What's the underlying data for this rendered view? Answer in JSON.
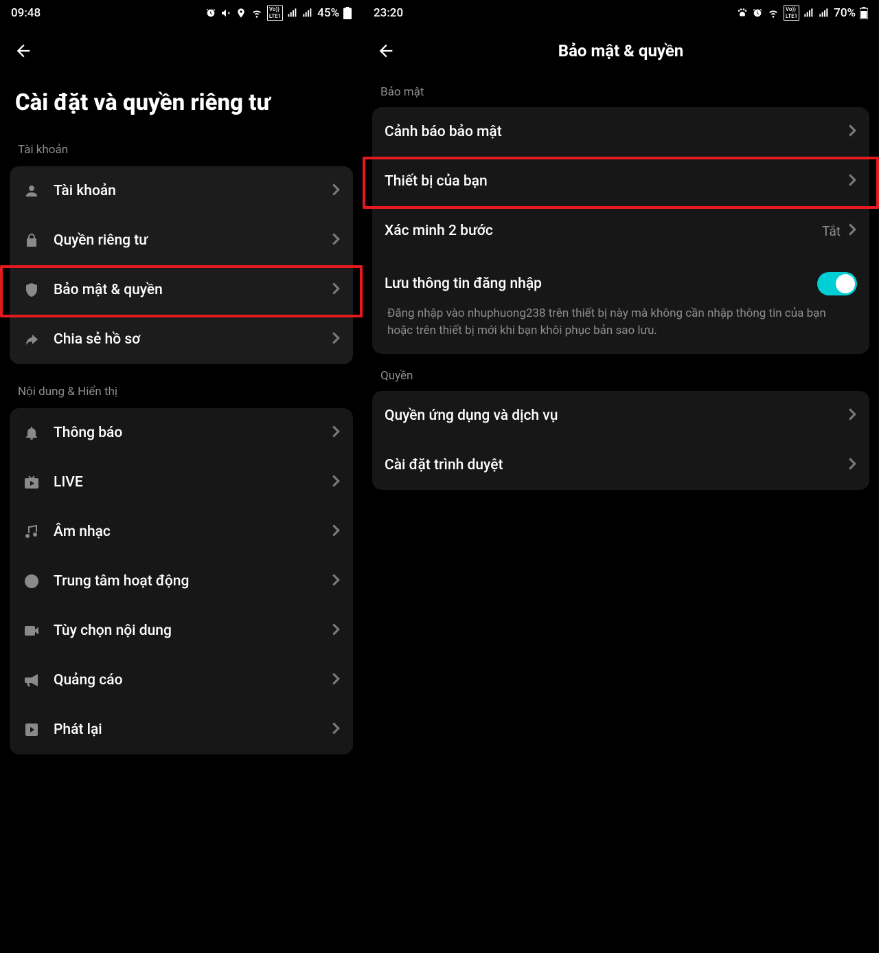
{
  "left": {
    "status": {
      "time": "09:48",
      "battery": "45%"
    },
    "title": "Cài đặt và quyền riêng tư",
    "section_account": "Tài khoản",
    "section_content": "Nội dung & Hiển thị",
    "rows_account": {
      "account": "Tài khoản",
      "privacy": "Quyền riêng tư",
      "security": "Bảo mật & quyền",
      "share": "Chia sẻ hồ sơ"
    },
    "rows_content": {
      "notify": "Thông báo",
      "live": "LIVE",
      "music": "Âm nhạc",
      "activity": "Trung tâm hoạt động",
      "content_pref": "Tùy chọn nội dung",
      "ads": "Quảng cáo",
      "playback": "Phát lại"
    }
  },
  "right": {
    "status": {
      "time": "23:20",
      "battery": "70%"
    },
    "title": "Bảo mật & quyền",
    "section_security": "Bảo mật",
    "section_permissions": "Quyền",
    "rows_security": {
      "alert": "Cảnh báo bảo mật",
      "device": "Thiết bị của bạn",
      "twostep": "Xác minh 2 bước",
      "twostep_value": "Tắt",
      "save_login": "Lưu thông tin đăng nhập",
      "save_login_desc": "Đăng nhập vào nhuphuong238 trên thiết bị này mà không cần nhập thông tin của bạn hoặc trên thiết bị mới khi bạn khôi phục bản sao lưu."
    },
    "rows_permissions": {
      "apps": "Quyền ứng dụng và dịch vụ",
      "browser": "Cài đặt trình duyệt"
    }
  }
}
